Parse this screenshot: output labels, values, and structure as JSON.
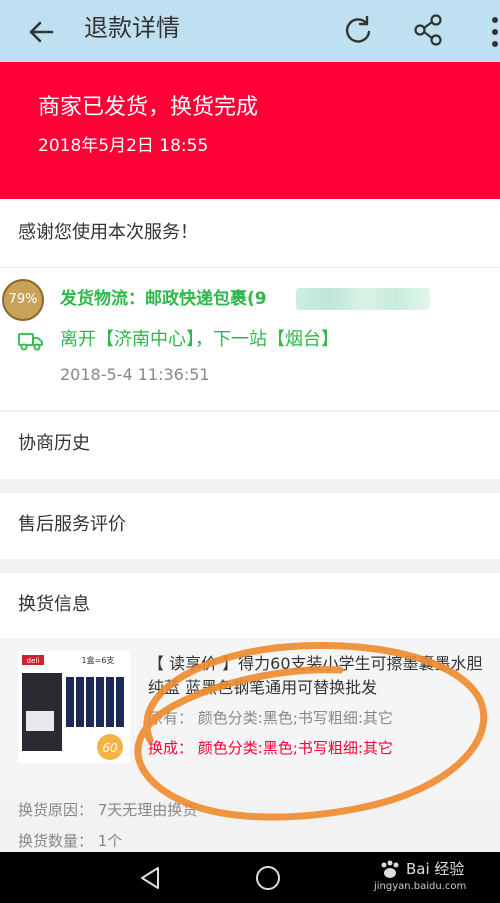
{
  "header": {
    "title": "退款详情",
    "back_icon": "back-arrow-icon",
    "refresh_icon": "refresh-icon",
    "share_icon": "share-icon",
    "more_icon": "more-vertical-icon"
  },
  "banner": {
    "status": "商家已发货，换货完成",
    "date": "2018年5月2日 18:55",
    "color": "#ff0036"
  },
  "thanks": {
    "text": "感谢您使用本次服务！"
  },
  "logistics": {
    "badge": "79%",
    "title": "发货物流：邮政快递包裹(9",
    "route": "离开【济南中心】，下一站【烟台】",
    "time": "2018-5-4 11:36:51",
    "color": "#2db84a"
  },
  "menu": {
    "history": "协商历史",
    "review": "售后服务评价",
    "exchange_info": "换货信息"
  },
  "product": {
    "name": "【 读享价 】得力60支装小学生可擦墨囊墨水胆纯蓝 蓝黑色钢笔通用可替换批发",
    "original": "原有：  颜色分类:黑色;书写粗细:其它",
    "changed": "换成：  颜色分类:黑色;书写粗细:其它",
    "thumb_brand": "deli",
    "thumb_label": "1盒=6支",
    "thumb_count": "60"
  },
  "details": {
    "reason": "换货原因：  7天无理由换货",
    "quantity": "换货数量：  1个"
  },
  "watermark": {
    "brand": "Bai 经验",
    "url": "jingyan.baidu.com"
  }
}
